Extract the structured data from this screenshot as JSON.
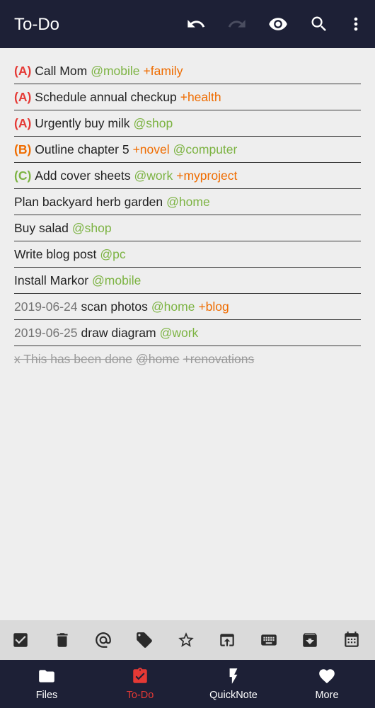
{
  "appbar": {
    "title": "To-Do",
    "actions": [
      "undo-icon",
      "redo-icon",
      "eye-icon",
      "search-icon",
      "more-vert-icon"
    ]
  },
  "colors": {
    "appbar_bg": "#1d2036",
    "background": "#eeeeee",
    "priority_a": "#e53935",
    "priority_b": "#ef6c00",
    "priority_c": "#7cb342",
    "context": "#7cb342",
    "project": "#ef6c00",
    "active_tab": "#e53935"
  },
  "tasks": [
    {
      "priority": "(A)",
      "priority_color": "#e53935",
      "text": "Call Mom",
      "context": "@mobile",
      "project": "+family"
    },
    {
      "priority": "(A)",
      "priority_color": "#e53935",
      "text": "Schedule annual checkup",
      "project": "+health"
    },
    {
      "priority": "(A)",
      "priority_color": "#e53935",
      "text": "Urgently buy milk",
      "context": "@shop"
    },
    {
      "priority": "(B)",
      "priority_color": "#ef6c00",
      "text": "Outline chapter 5",
      "project": "+novel",
      "context": "@computer"
    },
    {
      "priority": "(C)",
      "priority_color": "#7cb342",
      "text": "Add cover sheets",
      "context": "@work",
      "project": "+myproject"
    },
    {
      "text": "Plan backyard herb garden",
      "context": "@home"
    },
    {
      "text": "Buy salad",
      "context": "@shop"
    },
    {
      "text": "Write blog post",
      "context": "@pc"
    },
    {
      "text": "Install Markor",
      "context": "@mobile"
    },
    {
      "date": "2019-06-24",
      "text": "scan photos",
      "context": "@home",
      "project": "+blog"
    },
    {
      "date": "2019-06-25",
      "text": "draw diagram",
      "context": "@work"
    },
    {
      "done": true,
      "text": "x This has been done",
      "context": "@home",
      "project": "+renovations"
    }
  ],
  "toolbar": [
    "checkbox-icon",
    "delete-icon",
    "at-icon",
    "tag-icon",
    "star-icon",
    "open-in-icon",
    "keyboard-icon",
    "archive-icon",
    "calendar-icon"
  ],
  "bottom_nav": [
    {
      "label": "Files",
      "icon": "folder-icon"
    },
    {
      "label": "To-Do",
      "icon": "clipboard-check-icon",
      "active": true
    },
    {
      "label": "QuickNote",
      "icon": "bolt-icon"
    },
    {
      "label": "More",
      "icon": "heart-icon"
    }
  ]
}
